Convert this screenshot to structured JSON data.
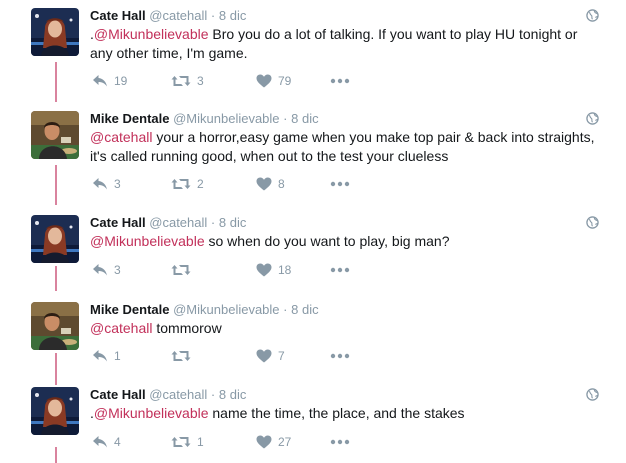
{
  "tweets": [
    {
      "name": "Cate Hall",
      "handle": "@catehall",
      "dot": "·",
      "date": "8 dic",
      "prefix": ".",
      "mention": "@Mikunbelievable",
      "text": " Bro you do a lot of talking. If you want to play HU tonight or any other time, I'm game.",
      "replies": "19",
      "retweets": "3",
      "likes": "79",
      "avatar": "cate-avatar"
    },
    {
      "name": "Mike Dentale",
      "handle": "@Mikunbelievable",
      "dot": "·",
      "date": "8 dic",
      "prefix": "",
      "mention": "@catehall",
      "text": " your a horror,easy game when you make top pair & back into straights, it's called running good, when out to the test your clueless",
      "replies": "3",
      "retweets": "2",
      "likes": "8",
      "avatar": "mike-avatar"
    },
    {
      "name": "Cate Hall",
      "handle": "@catehall",
      "dot": "·",
      "date": "8 dic",
      "prefix": "",
      "mention": "@Mikunbelievable",
      "text": " so when do you want to play, big man?",
      "replies": "3",
      "retweets": "",
      "likes": "18",
      "avatar": "cate-avatar"
    },
    {
      "name": "Mike Dentale",
      "handle": "@Mikunbelievable",
      "dot": "·",
      "date": "8 dic",
      "prefix": "",
      "mention": "@catehall",
      "text": " tommorow",
      "replies": "1",
      "retweets": "",
      "likes": "7",
      "avatar": "mike-avatar"
    },
    {
      "name": "Cate Hall",
      "handle": "@catehall",
      "dot": "·",
      "date": "8 dic",
      "prefix": ".",
      "mention": "@Mikunbelievable",
      "text": " name the time, the place, and the stakes",
      "replies": "4",
      "retweets": "1",
      "likes": "27",
      "avatar": "cate-avatar"
    }
  ],
  "icons": {
    "reply": "reply-icon",
    "retweet": "retweet-icon",
    "like": "heart-icon",
    "more": "more-dots-icon",
    "globe": "globe-icon"
  },
  "colors": {
    "mention": "#c2305a",
    "thread_line": "#d9839e",
    "meta": "#8899a6"
  }
}
